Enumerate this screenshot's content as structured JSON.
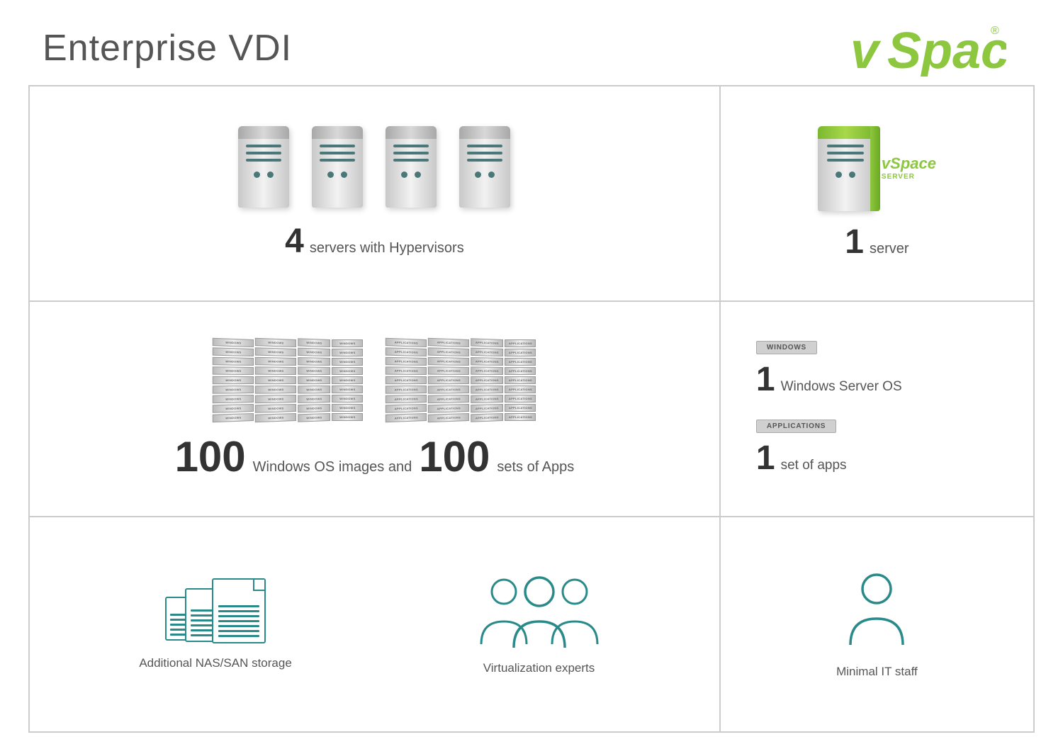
{
  "page": {
    "title": "Enterprise VDI",
    "background": "#ffffff"
  },
  "logo": {
    "text": "vSpace",
    "symbol": "®"
  },
  "grid": {
    "left_top": {
      "servers_count": "4",
      "servers_label": "servers with Hypervisors"
    },
    "right_top": {
      "count": "1",
      "label": "server",
      "vspace_server_label": "vSpace",
      "vspace_server_sublabel": "SERVER"
    },
    "left_mid": {
      "count1": "100",
      "label1": "Windows OS images and",
      "count2": "100",
      "label2": "sets of Apps",
      "windows_label": "WINDOWS",
      "apps_label": "APPLICATIONS"
    },
    "right_mid": {
      "windows_count": "1",
      "windows_label": "Windows Server OS",
      "windows_badge": "WINDOWS",
      "apps_count": "1",
      "apps_label": "set of apps",
      "apps_badge": "APPLICATIONS"
    },
    "left_bot": {
      "label": "Additional NAS/SAN storage"
    },
    "mid_bot": {
      "label": "Virtualization experts"
    },
    "right_bot": {
      "label": "Minimal IT staff"
    }
  },
  "colors": {
    "teal": "#2a8a8a",
    "green": "#8dc63f",
    "dark_green": "#5a8833",
    "text_dark": "#333333",
    "text_mid": "#555555",
    "border": "#cccccc",
    "server_line": "#4a7878",
    "badge_bg": "#d4d4d4"
  }
}
